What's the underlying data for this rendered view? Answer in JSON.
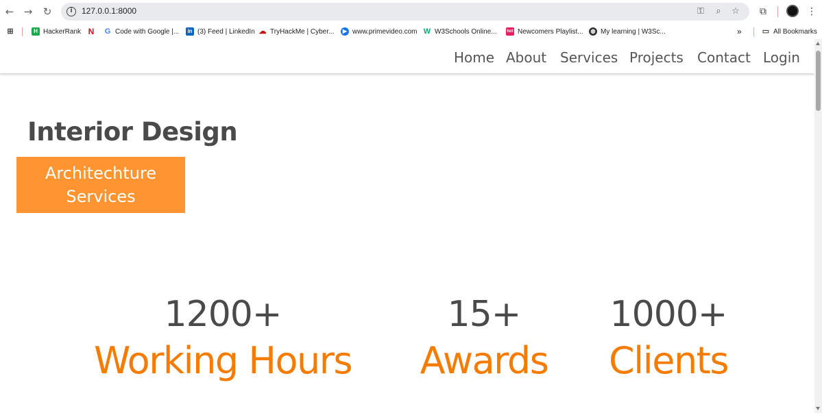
{
  "browser": {
    "url": "127.0.0.1:8000",
    "bookmarks": [
      {
        "label": "HackerRank",
        "icon": "hackerrank-icon",
        "color": "#1ba94c"
      },
      {
        "label": "",
        "icon": "netflix-icon",
        "color": "#e50914"
      },
      {
        "label": "Code with Google |...",
        "icon": "google-icon",
        "color": "#4285f4"
      },
      {
        "label": "(3) Feed | LinkedIn",
        "icon": "linkedin-icon",
        "color": "#0a66c2"
      },
      {
        "label": "TryHackMe | Cyber...",
        "icon": "tryhackme-icon",
        "color": "#c11111"
      },
      {
        "label": "www.primevideo.com",
        "icon": "primevideo-icon",
        "color": "#1a73e8"
      },
      {
        "label": "W3Schools Online...",
        "icon": "w3schools-icon",
        "color": "#04aa6d"
      },
      {
        "label": "Newcomers Playlist...",
        "icon": "playlist-icon",
        "color": "#e91e63"
      },
      {
        "label": "My learning | W3Sc...",
        "icon": "globe-icon",
        "color": "#333333"
      }
    ],
    "more_label": "»",
    "all_bookmarks": "All Bookmarks"
  },
  "nav": {
    "home": "Home",
    "about": "About",
    "services": "Services",
    "projects": "Projects",
    "contact": "Contact",
    "login": "Login"
  },
  "hero": {
    "title": "Interior Design",
    "badge_line1": "Architechture",
    "badge_line2": "Services"
  },
  "stats": [
    {
      "number": "1200+",
      "label": "Working Hours"
    },
    {
      "number": "15+",
      "label": "Awards"
    },
    {
      "number": "1000+",
      "label": "Clients"
    }
  ],
  "colors": {
    "accent": "#ff9430",
    "stat_label": "#f57c00",
    "text": "#4a4a4a"
  }
}
